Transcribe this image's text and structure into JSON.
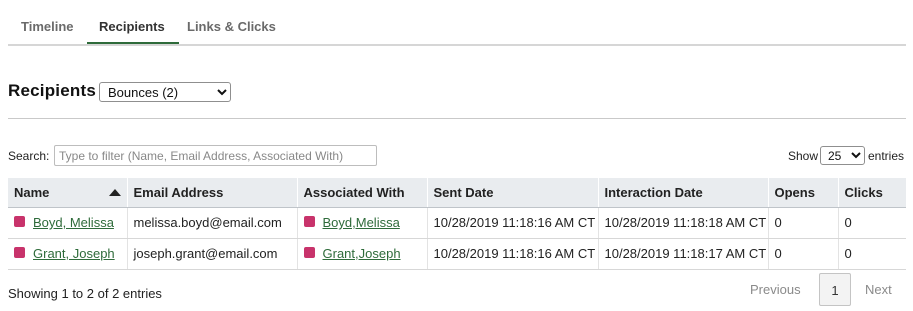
{
  "tabs": [
    {
      "label": "Timeline"
    },
    {
      "label": "Recipients"
    },
    {
      "label": "Links & Clicks"
    }
  ],
  "section": {
    "title": "Recipients",
    "filter_selected": "Bounces (2)"
  },
  "search": {
    "label": "Search:",
    "placeholder": "Type to filter (Name, Email Address, Associated With)"
  },
  "length": {
    "show_label": "Show",
    "selected": "25",
    "entries_label": "entries"
  },
  "table": {
    "columns": [
      "Name",
      "Email Address",
      "Associated With",
      "Sent Date",
      "Interaction Date",
      "Opens",
      "Clicks"
    ],
    "sorted_column": "Name",
    "marker_color": "#c8336b",
    "rows": [
      {
        "name": "Boyd, Melissa",
        "email": "melissa.boyd@email.com",
        "associated": "Boyd,Melissa",
        "sent": "10/28/2019 11:18:16 AM CT",
        "interaction": "10/28/2019 11:18:18 AM CT",
        "opens": "0",
        "clicks": "0"
      },
      {
        "name": "Grant, Joseph",
        "email": "joseph.grant@email.com",
        "associated": "Grant,Joseph",
        "sent": "10/28/2019 11:18:16 AM CT",
        "interaction": "10/28/2019 11:18:17 AM CT",
        "opens": "0",
        "clicks": "0"
      }
    ]
  },
  "footer": {
    "info": "Showing 1 to 2 of 2 entries",
    "previous": "Previous",
    "current_page": "1",
    "next": "Next"
  },
  "colors": {
    "accent": "#2e6b3a",
    "header_bg": "#e9ecef"
  }
}
